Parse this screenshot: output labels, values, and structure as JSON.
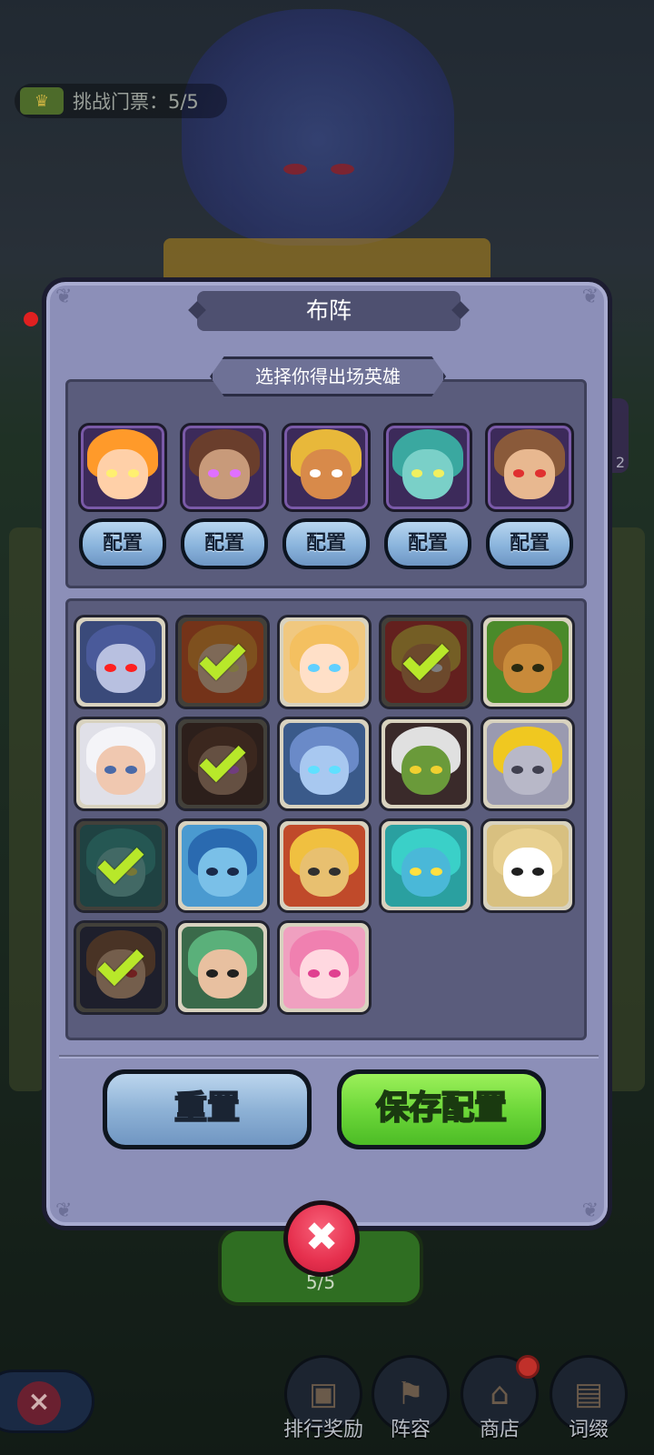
{
  "background": {
    "ticket_label": "挑战门票：5/5",
    "bottom_counter": "5/5",
    "side_badge_count": "2",
    "nav": [
      {
        "label": "排行奖励",
        "icon": "chest-icon"
      },
      {
        "label": "阵容",
        "icon": "flag-icon"
      },
      {
        "label": "商店",
        "icon": "shop-icon",
        "has_badge": true
      },
      {
        "label": "词缀",
        "icon": "card-icon"
      }
    ]
  },
  "dialog": {
    "title": "布阵",
    "subtitle": "选择你得出场英雄",
    "config_label": "配置",
    "reset_label": "重置",
    "save_label": "保存配置",
    "close_label": "✖"
  },
  "selected_slots": [
    {
      "hero": "fire-spirit"
    },
    {
      "hero": "hooded-assassin"
    },
    {
      "hero": "golden-warrior"
    },
    {
      "hero": "owl-druid"
    },
    {
      "hero": "monkey-king"
    }
  ],
  "roster": [
    {
      "hero": "dark-elf-ranger",
      "selected": false
    },
    {
      "hero": "fire-spirit",
      "selected": true
    },
    {
      "hero": "blonde-priestess",
      "selected": false
    },
    {
      "hero": "golden-warrior",
      "selected": true
    },
    {
      "hero": "tree-ent",
      "selected": false
    },
    {
      "hero": "old-wizard",
      "selected": false
    },
    {
      "hero": "hooded-assassin",
      "selected": true
    },
    {
      "hero": "ice-lich-king",
      "selected": false
    },
    {
      "hero": "goblin-shaman",
      "selected": false
    },
    {
      "hero": "stone-golem",
      "selected": false
    },
    {
      "hero": "owl-druid",
      "selected": true
    },
    {
      "hero": "blue-troll",
      "selected": false
    },
    {
      "hero": "goggle-mechanic",
      "selected": false
    },
    {
      "hero": "fish-warrior",
      "selected": false
    },
    {
      "hero": "panda-monk",
      "selected": false
    },
    {
      "hero": "monkey-king",
      "selected": true
    },
    {
      "hero": "green-hair-swordsman",
      "selected": false
    },
    {
      "hero": "pink-fox-girl",
      "selected": false
    }
  ],
  "colors": {
    "panel": "#8c8fb8",
    "save_green": "#6ed83a",
    "reset_blue": "#8eb2d6",
    "check": "#b8e82a",
    "close_red": "#e6304e"
  }
}
